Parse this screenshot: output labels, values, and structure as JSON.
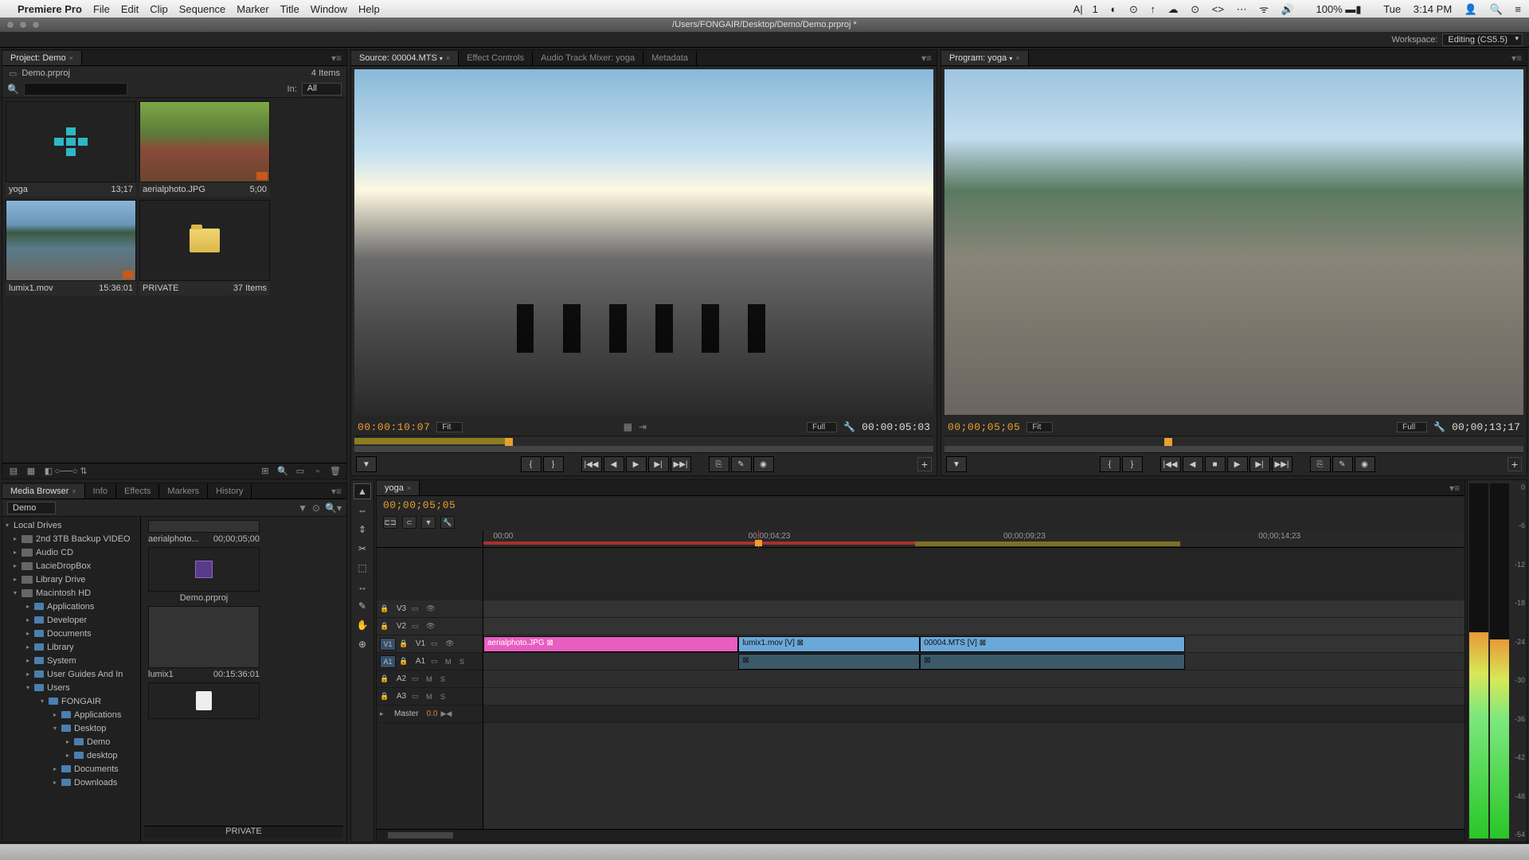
{
  "mac_menu": {
    "app": "Premiere Pro",
    "items": [
      "File",
      "Edit",
      "Clip",
      "Sequence",
      "Marker",
      "Title",
      "Window",
      "Help"
    ],
    "right_badge": "1",
    "battery": "100%",
    "day": "Tue",
    "time": "3:14 PM"
  },
  "titlebar": "/Users/FONGAIR/Desktop/Demo/Demo.prproj *",
  "workspace": {
    "label": "Workspace:",
    "value": "Editing (CS5.5)"
  },
  "project_panel": {
    "tab": "Project: Demo",
    "filename": "Demo.prproj",
    "item_count": "4 Items",
    "search_placeholder": "",
    "in_label": "In:",
    "in_value": "All",
    "items": [
      {
        "name": "yoga",
        "meta": "13;17",
        "kind": "sequence"
      },
      {
        "name": "aerialphoto.JPG",
        "meta": "5;00",
        "kind": "image"
      },
      {
        "name": "lumix1.mov",
        "meta": "15:36:01",
        "kind": "video"
      },
      {
        "name": "PRIVATE",
        "meta": "37 Items",
        "kind": "folder"
      }
    ]
  },
  "media_browser": {
    "tabs": [
      "Media Browser",
      "Info",
      "Effects",
      "Markers",
      "History"
    ],
    "selector": "Demo",
    "tree_root": "Local Drives",
    "drives": [
      "2nd 3TB Backup VIDEO",
      "Audio CD",
      "LacieDropBox",
      "Library Drive",
      "Macintosh HD"
    ],
    "mac_folders": [
      "Applications",
      "Developer",
      "Documents",
      "Library",
      "System",
      "User Guides And In",
      "Users"
    ],
    "user": "FONGAIR",
    "user_folders": [
      "Applications",
      "Desktop"
    ],
    "desktop_folders": [
      "Demo",
      "desktop"
    ],
    "more_user_folders": [
      "Documents",
      "Downloads"
    ],
    "items": [
      {
        "name": "aerialphoto...",
        "meta": "00;00;05;00"
      },
      {
        "name": "Demo.prproj",
        "meta": ""
      },
      {
        "name": "lumix1",
        "meta": "00:15:36:01"
      }
    ],
    "footer": "PRIVATE"
  },
  "source_monitor": {
    "tabs": [
      "Source: 00004.MTS",
      "Effect Controls",
      "Audio Track Mixer: yoga",
      "Metadata"
    ],
    "tc_left": "00:00:10:07",
    "fit": "Fit",
    "full": "Full",
    "tc_right": "00:00:05:03"
  },
  "program_monitor": {
    "tab": "Program: yoga",
    "tc_left": "00;00;05;05",
    "fit": "Fit",
    "full": "Full",
    "tc_right": "00;00;13;17"
  },
  "transport_icons": [
    "{",
    "}",
    "|◀◀",
    "◀",
    "▶",
    "▶|",
    "▶▶|",
    "⎘",
    "✎",
    "◉"
  ],
  "program_transport_icons": [
    "{",
    "}",
    "|◀◀",
    "◀",
    "■",
    "▶",
    "▶|",
    "▶▶|",
    "⎘",
    "✎",
    "◉"
  ],
  "timeline": {
    "tab": "yoga",
    "playhead_tc": "00;00;05;05",
    "ruler": [
      "00;00",
      "00;00;04;23",
      "00;00;09;23",
      "00;00;14;23"
    ],
    "video_tracks": [
      "V3",
      "V2",
      "V1"
    ],
    "audio_tracks": [
      "A1",
      "A2",
      "A3"
    ],
    "master_label": "Master",
    "master_value": "0.0",
    "v1_target": "V1",
    "a1_target": "A1",
    "clips": [
      {
        "name": "aerialphoto.JPG",
        "color": "pink"
      },
      {
        "name": "lumix1.mov [V]",
        "color": "blue"
      },
      {
        "name": "00004.MTS [V]",
        "color": "blue"
      }
    ]
  },
  "tools": [
    "▲",
    "⇔",
    "⇕",
    "✂",
    "⬚",
    "↔",
    "✎",
    "✋",
    "⊕"
  ],
  "meter_ticks": [
    "0",
    "-6",
    "-12",
    "-18",
    "-24",
    "-30",
    "-36",
    "-42",
    "-48",
    "-54"
  ]
}
